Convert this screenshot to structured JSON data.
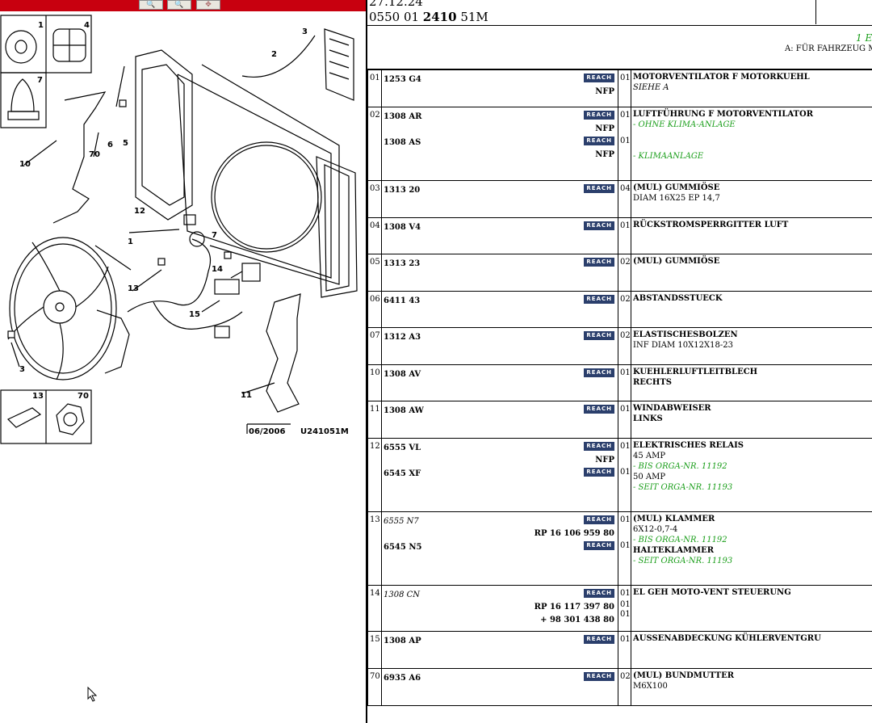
{
  "header": {
    "date": "27.12.24",
    "ref_pre": "0550 01 ",
    "ref_bold": "2410",
    "ref_post": " 51M",
    "green_note": "1 E",
    "note": "A: FÜR FAHRZEUG MI"
  },
  "diagram": {
    "callouts": [
      "1",
      "2",
      "3",
      "3",
      "4",
      "5",
      "5",
      "6",
      "7",
      "7",
      "10",
      "11",
      "12",
      "13",
      "13",
      "14",
      "15",
      "70",
      "70"
    ],
    "stamp_date": "06/2006",
    "stamp_code": "U241051M"
  },
  "parts": [
    {
      "num": "01",
      "refs": [
        {
          "ref": "1253 G4",
          "qty": "01",
          "italic": false,
          "extra": [
            "NFP"
          ]
        }
      ],
      "desc": [
        {
          "t": "MOTORVENTILATOR F MOTORKUEHL",
          "s": "b"
        },
        {
          "t": "SIEHE A",
          "s": "it"
        }
      ]
    },
    {
      "num": "02",
      "refs": [
        {
          "ref": "1308 AR",
          "qty": "01",
          "italic": false,
          "extra": [
            "NFP"
          ]
        },
        {
          "ref": "1308 AS",
          "qty": "01",
          "italic": false,
          "extra": [
            "NFP"
          ]
        }
      ],
      "desc": [
        {
          "t": "LUFTFÜHRUNG F MOTORVENTILATOR",
          "s": "b"
        },
        {
          "t": "- OHNE KLIMA-ANLAGE",
          "s": "g"
        },
        {
          "t": "",
          "s": ""
        },
        {
          "t": "",
          "s": ""
        },
        {
          "t": "- KLIMAANLAGE",
          "s": "g"
        }
      ]
    },
    {
      "num": "03",
      "refs": [
        {
          "ref": "1313 20",
          "qty": "04",
          "italic": false,
          "extra": []
        }
      ],
      "desc": [
        {
          "t": "(MUL) GUMMIÖSE",
          "s": "b"
        },
        {
          "t": "DIAM 16X25 EP 14,7",
          "s": ""
        }
      ]
    },
    {
      "num": "04",
      "refs": [
        {
          "ref": "1308 V4",
          "qty": "01",
          "italic": false,
          "extra": []
        }
      ],
      "desc": [
        {
          "t": "RÜCKSTROMSPERRGITTER LUFT",
          "s": "b"
        }
      ]
    },
    {
      "num": "05",
      "refs": [
        {
          "ref": "1313 23",
          "qty": "02",
          "italic": false,
          "extra": []
        }
      ],
      "desc": [
        {
          "t": "(MUL) GUMMIÖSE",
          "s": "b"
        }
      ]
    },
    {
      "num": "06",
      "refs": [
        {
          "ref": "6411 43",
          "qty": "02",
          "italic": false,
          "extra": []
        }
      ],
      "desc": [
        {
          "t": "ABSTANDSSTUECK",
          "s": "b"
        }
      ]
    },
    {
      "num": "07",
      "refs": [
        {
          "ref": "1312 A3",
          "qty": "02",
          "italic": false,
          "extra": []
        }
      ],
      "desc": [
        {
          "t": "ELASTISCHESBOLZEN",
          "s": "b"
        },
        {
          "t": "INF DIAM 10X12X18-23",
          "s": ""
        }
      ]
    },
    {
      "num": "10",
      "refs": [
        {
          "ref": "1308 AV",
          "qty": "01",
          "italic": false,
          "extra": []
        }
      ],
      "desc": [
        {
          "t": "KUEHLERLUFTLEITBLECH",
          "s": "b"
        },
        {
          "t": "RECHTS",
          "s": "b"
        }
      ]
    },
    {
      "num": "11",
      "refs": [
        {
          "ref": "1308 AW",
          "qty": "01",
          "italic": false,
          "extra": []
        }
      ],
      "desc": [
        {
          "t": "WINDABWEISER",
          "s": "b"
        },
        {
          "t": "LINKS",
          "s": "b"
        }
      ]
    },
    {
      "num": "12",
      "refs": [
        {
          "ref": "6555 VL",
          "qty": "01",
          "italic": false,
          "extra": [
            "NFP"
          ]
        },
        {
          "ref": "6545 XF",
          "qty": "01",
          "italic": false,
          "extra": []
        }
      ],
      "desc": [
        {
          "t": "ELEKTRISCHES RELAIS",
          "s": "b"
        },
        {
          "t": "45 AMP",
          "s": ""
        },
        {
          "t": "- BIS ORGA-NR. 11192",
          "s": "g"
        },
        {
          "t": "50 AMP",
          "s": ""
        },
        {
          "t": "- SEIT ORGA-NR. 11193",
          "s": "g"
        }
      ]
    },
    {
      "num": "13",
      "refs": [
        {
          "ref": "6555 N7",
          "qty": "01",
          "italic": true,
          "extra": [
            "RP 16 106 959 80"
          ]
        },
        {
          "ref": "6545 N5",
          "qty": "01",
          "italic": false,
          "extra": []
        }
      ],
      "desc": [
        {
          "t": "(MUL) KLAMMER",
          "s": "b"
        },
        {
          "t": "6X12-0,7-4",
          "s": ""
        },
        {
          "t": "- BIS ORGA-NR. 11192",
          "s": "g"
        },
        {
          "t": "HALTEKLAMMER",
          "s": "b"
        },
        {
          "t": "- SEIT ORGA-NR. 11193",
          "s": "g"
        }
      ]
    },
    {
      "num": "14",
      "refs": [
        {
          "ref": "1308 CN",
          "qty": "01",
          "italic": true,
          "extra": [
            "RP 16 117 397 80",
            "+ 98 301 438 80"
          ]
        }
      ],
      "qty_extra": [
        "01",
        "01"
      ],
      "desc": [
        {
          "t": "EL GEH MOTO-VENT STEUERUNG",
          "s": "b"
        }
      ]
    },
    {
      "num": "15",
      "refs": [
        {
          "ref": "1308 AP",
          "qty": "01",
          "italic": false,
          "extra": []
        }
      ],
      "desc": [
        {
          "t": "AUSSENABDECKUNG KÜHLERVENTGRU",
          "s": "b"
        }
      ]
    },
    {
      "num": "70",
      "refs": [
        {
          "ref": "6935 A6",
          "qty": "02",
          "italic": false,
          "extra": []
        }
      ],
      "desc": [
        {
          "t": "(MUL) BUNDMUTTER",
          "s": "b"
        },
        {
          "t": "M6X100",
          "s": ""
        }
      ]
    }
  ],
  "badge_label": "REACH",
  "row_heights": {},
  "colors": {
    "toolbar": "#c8000f",
    "badge": "#2b3f6c",
    "green": "#1a9e1a"
  },
  "icons": [
    "zoom-in-icon",
    "zoom-out-icon",
    "move-icon",
    "mouse-cursor-icon"
  ]
}
